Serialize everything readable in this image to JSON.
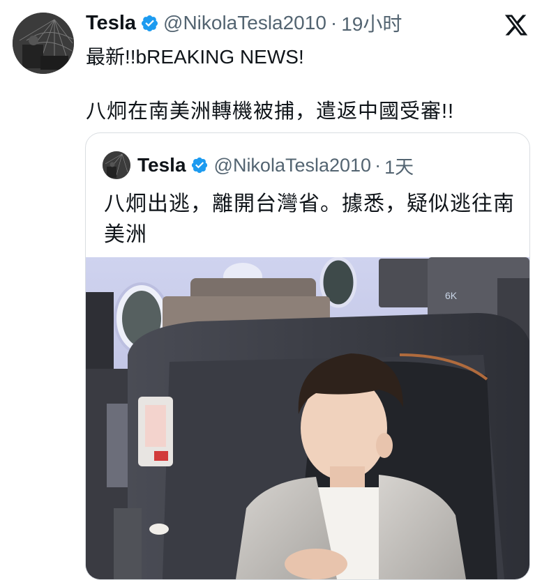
{
  "tweet": {
    "author_name": "Tesla",
    "handle": "@NikolaTesla2010",
    "separator": "·",
    "time": "19小时",
    "line1": "最新!!bREAKING NEWS!",
    "line2": "八炯在南美洲轉機被捕，遣返中國受審!!"
  },
  "quoted": {
    "author_name": "Tesla",
    "handle": "@NikolaTesla2010",
    "separator": "·",
    "time": "1天",
    "text": "八炯出逃，離開台灣省。據悉，疑似逃往南美洲"
  },
  "icons": {
    "verified": "verified-badge-icon",
    "platform": "x-logo-icon"
  },
  "colors": {
    "verified_blue": "#1d9bf0",
    "secondary_text": "#536471",
    "primary_text": "#0f1419"
  }
}
